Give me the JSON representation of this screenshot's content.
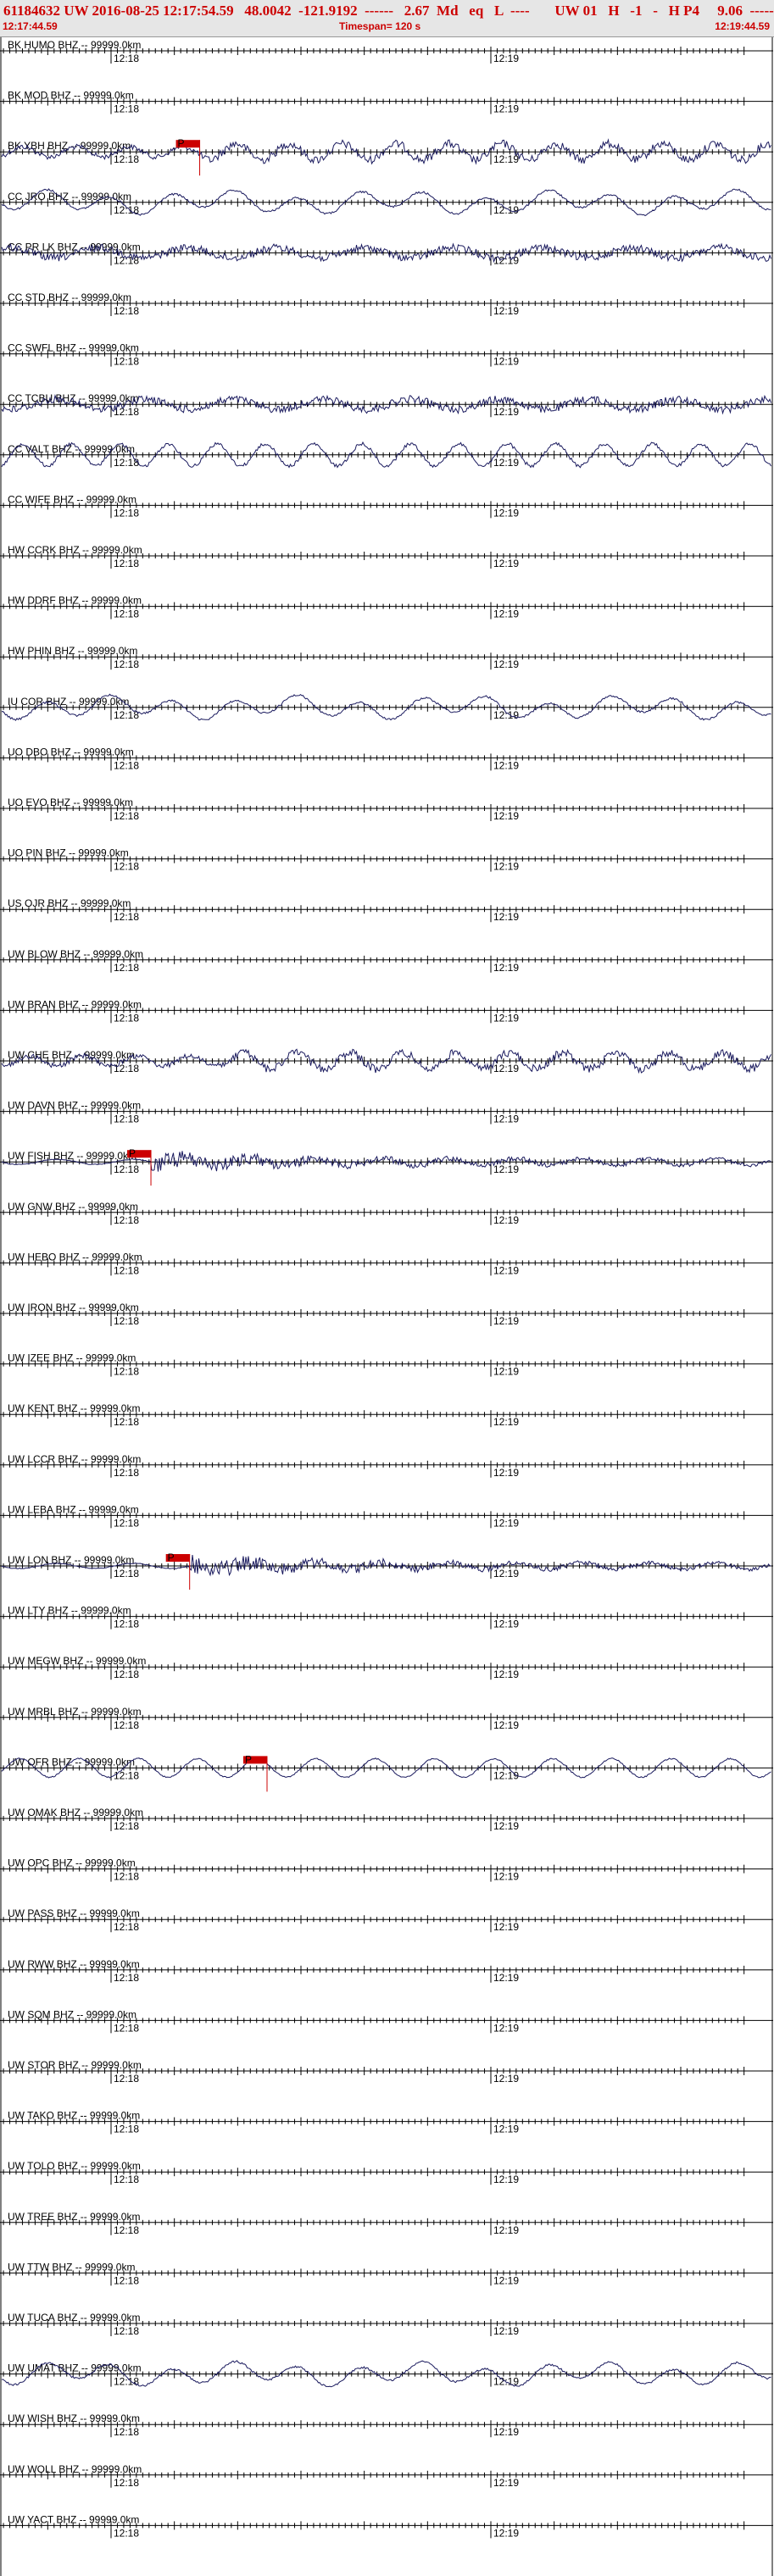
{
  "header": {
    "title": "61184632 UW 2016-08-25 12:17:54.59   48.0042  -121.9192  ------   2.67  Md   eq   L  ----       UW 01   H   -1   -   H P4     9.06  ------",
    "start_time": "12:17:44.59",
    "timespan": "Timespan= 120 s",
    "end_time": "12:19:44.59"
  },
  "colors": {
    "header_text": "#cc0000",
    "header_bg": "#e6e6e6",
    "trace": "#1a1a5e",
    "pick": "#cc0000",
    "axis": "#000000"
  },
  "minute_labels": [
    "12:18",
    "12:19"
  ],
  "channels": [
    {
      "label": "BK HUMO BHZ -- 99999.0km",
      "trace": "none"
    },
    {
      "label": "BK MOD BHZ -- 99999.0km",
      "trace": "none"
    },
    {
      "label": "BK YBH BHZ -- 99999.0km",
      "trace": "active",
      "pick": {
        "label": "P",
        "time": 0.258
      }
    },
    {
      "label": "CC JRO BHZ -- 99999.0km",
      "trace": "lowfreq"
    },
    {
      "label": "CC PR LK BHZ -- 99999.0km",
      "trace": "noisy"
    },
    {
      "label": "CC STD BHZ -- 99999.0km",
      "trace": "none"
    },
    {
      "label": "CC SWFL BHZ -- 99999.0km",
      "trace": "none"
    },
    {
      "label": "CC TCBU BHZ -- 99999.0km",
      "trace": "noisy"
    },
    {
      "label": "CC VALT BHZ -- 99999.0km",
      "trace": "wave"
    },
    {
      "label": "CC WIFE BHZ -- 99999.0km",
      "trace": "none"
    },
    {
      "label": "HW CCRK BHZ -- 99999.0km",
      "trace": "none"
    },
    {
      "label": "HW DDRF BHZ -- 99999.0km",
      "trace": "none"
    },
    {
      "label": "HW PHIN BHZ -- 99999.0km",
      "trace": "none"
    },
    {
      "label": "IU COR BHZ -- 99999.0km",
      "trace": "lowfreq"
    },
    {
      "label": "UO DBO BHZ -- 99999.0km",
      "trace": "none"
    },
    {
      "label": "UO EVO BHZ -- 99999.0km",
      "trace": "none"
    },
    {
      "label": "UO PIN BHZ -- 99999.0km",
      "trace": "none"
    },
    {
      "label": "US OJR BHZ -- 99999.0km",
      "trace": "none"
    },
    {
      "label": "UW BLOW BHZ -- 99999.0km",
      "trace": "none"
    },
    {
      "label": "UW BRAN BHZ -- 99999.0km",
      "trace": "none"
    },
    {
      "label": "UW CHE BHZ -- 99999.0km",
      "trace": "active"
    },
    {
      "label": "UW DAVN BHZ -- 99999.0km",
      "trace": "none"
    },
    {
      "label": "UW FISH BHZ -- 99999.0km",
      "trace": "quake",
      "pick": {
        "label": "P",
        "time": 0.195
      }
    },
    {
      "label": "UW GNW BHZ -- 99999.0km",
      "trace": "none"
    },
    {
      "label": "UW HEBO BHZ -- 99999.0km",
      "trace": "none"
    },
    {
      "label": "UW IRON BHZ -- 99999.0km",
      "trace": "none"
    },
    {
      "label": "UW IZEE BHZ -- 99999.0km",
      "trace": "none"
    },
    {
      "label": "UW KENT BHZ -- 99999.0km",
      "trace": "none"
    },
    {
      "label": "UW LCCR BHZ -- 99999.0km",
      "trace": "none"
    },
    {
      "label": "UW LEBA BHZ -- 99999.0km",
      "trace": "none"
    },
    {
      "label": "UW LON BHZ -- 99999.0km",
      "trace": "quake",
      "pick": {
        "label": "P",
        "time": 0.245
      }
    },
    {
      "label": "UW LTY BHZ -- 99999.0km",
      "trace": "none"
    },
    {
      "label": "UW MEGW BHZ -- 99999.0km",
      "trace": "none"
    },
    {
      "label": "UW MRBL BHZ -- 99999.0km",
      "trace": "none"
    },
    {
      "label": "UW OFR BHZ -- 99999.0km",
      "trace": "smooth",
      "pick": {
        "label": "P",
        "time": 0.345
      }
    },
    {
      "label": "UW OMAK BHZ -- 99999.0km",
      "trace": "none"
    },
    {
      "label": "UW OPC BHZ -- 99999.0km",
      "trace": "none"
    },
    {
      "label": "UW PASS BHZ -- 99999.0km",
      "trace": "none"
    },
    {
      "label": "UW RWW BHZ -- 99999.0km",
      "trace": "none"
    },
    {
      "label": "UW SQM BHZ -- 99999.0km",
      "trace": "none"
    },
    {
      "label": "UW STOR BHZ -- 99999.0km",
      "trace": "none"
    },
    {
      "label": "UW TAKO BHZ -- 99999.0km",
      "trace": "none"
    },
    {
      "label": "UW TOLO BHZ -- 99999.0km",
      "trace": "none"
    },
    {
      "label": "UW TREE BHZ -- 99999.0km",
      "trace": "none"
    },
    {
      "label": "UW TTW BHZ -- 99999.0km",
      "trace": "none"
    },
    {
      "label": "UW TUCA BHZ -- 99999.0km",
      "trace": "none"
    },
    {
      "label": "UW UMAT BHZ -- 99999.0km",
      "trace": "lowfreq"
    },
    {
      "label": "UW WISH BHZ -- 99999.0km",
      "trace": "none"
    },
    {
      "label": "UW WOLL BHZ -- 99999.0km",
      "trace": "none"
    },
    {
      "label": "UW YACT BHZ -- 99999.0km",
      "trace": "none"
    }
  ]
}
